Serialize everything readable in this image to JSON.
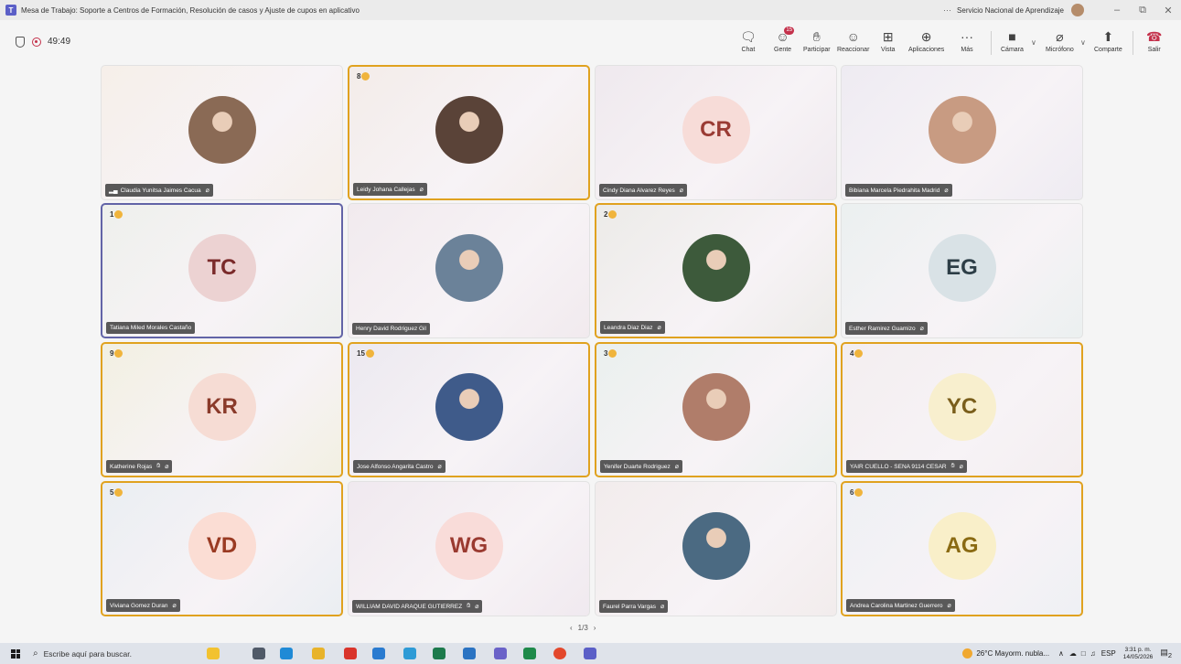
{
  "window": {
    "title": "Mesa de Trabajo: Soporte a Centros de Formación, Resolución de casos y Ajuste de cupos en aplicativo",
    "org": "Servicio Nacional de Aprendizaje",
    "more": "···",
    "minimize": "–",
    "restore": "⧉",
    "close": "✕"
  },
  "meeting": {
    "timer": "49:49",
    "buttons": {
      "chat": "Chat",
      "people": "Gente",
      "people_badge": "15",
      "raise": "Participar",
      "react": "Reaccionar",
      "view": "Vista",
      "apps": "Aplicaciones",
      "more": "Más",
      "camera": "Cámara",
      "mic": "Micrófono",
      "share": "Comparte",
      "leave": "Salir"
    }
  },
  "participants": [
    {
      "name": "Claudia Yunitsa Jaimes Cacua",
      "initials": "",
      "hand": "",
      "photo_color": "#8a6a55",
      "bg": "#f6efe9",
      "signal": "true"
    },
    {
      "name": "Leidy Johana Callejas",
      "initials": "",
      "hand": "8",
      "photo_color": "#5a4338",
      "bg": "#f3ece9"
    },
    {
      "name": "Cindy Diana Alvarez Reyes",
      "initials": "CR",
      "hand": "",
      "circle": "#f7dcd8",
      "fg": "#9a3b34",
      "bg": "#efe9ee"
    },
    {
      "name": "Bibiana Marcela Piedrahita Madrid",
      "initials": "",
      "hand": "",
      "photo_color": "#c89b82",
      "bg": "#eeebf2"
    },
    {
      "name": "Tatiana Miled Morales Castaño",
      "initials": "TC",
      "hand": "1",
      "circle": "#ecd2d2",
      "fg": "#7a2a2a",
      "bg": "#eef0ec",
      "active": "true"
    },
    {
      "name": "Henry David Rodriguez Gil",
      "initials": "",
      "hand": "",
      "photo_color": "#6b8299",
      "bg": "#f1eaee"
    },
    {
      "name": "Leandra Diaz Diaz",
      "initials": "",
      "hand": "2",
      "photo_color": "#3d5a3b",
      "bg": "#ecebe8"
    },
    {
      "name": "Esther Ramirez Guamizo",
      "initials": "EG",
      "hand": "",
      "circle": "#d9e2e6",
      "fg": "#2d3e47",
      "bg": "#ebf0f0"
    },
    {
      "name": "Katherine Rojas",
      "initials": "KR",
      "hand": "9",
      "circle": "#f6dcd4",
      "fg": "#8a3a2a",
      "bg": "#f2f0e2",
      "extra": "true"
    },
    {
      "name": "Jose Alfonso Angarita Castro",
      "initials": "",
      "hand": "15",
      "photo_color": "#3f5b8a",
      "bg": "#ece9f0"
    },
    {
      "name": "Yenifer Duarte Rodriguez",
      "initials": "",
      "hand": "3",
      "photo_color": "#b07d6a",
      "bg": "#eaf0ee"
    },
    {
      "name": "YAIR CUELLO - SENA 9114 CESAR",
      "initials": "YC",
      "hand": "4",
      "circle": "#f8efce",
      "fg": "#7a5e1b",
      "bg": "#f3eef0",
      "extra": "true"
    },
    {
      "name": "Viviana Gomez Duran",
      "initials": "VD",
      "hand": "5",
      "circle": "#fbddd4",
      "fg": "#9a3a22",
      "bg": "#eaeef2"
    },
    {
      "name": "WILLIAM DAVID ARAQUE GUTIERREZ",
      "initials": "WG",
      "hand": "",
      "circle": "#f9dcd9",
      "fg": "#9a3a30",
      "bg": "#f0e9ef",
      "extra": "true"
    },
    {
      "name": "Faurel Parra Vargas",
      "initials": "",
      "hand": "",
      "photo_color": "#4b6a82",
      "bg": "#f2ecec"
    },
    {
      "name": "Andrea Carolina Martinez Guerrero",
      "initials": "AG",
      "hand": "6",
      "circle": "#f9efc9",
      "fg": "#8a6a12",
      "bg": "#eef0f4"
    }
  ],
  "pager": {
    "prev": "‹",
    "label": "1/3",
    "next": "›"
  },
  "taskbar": {
    "search_placeholder": "Escribe aquí para buscar.",
    "weather": "26°C  Mayorm. nubla...",
    "lang": "ESP",
    "time": "3:31 p. m.",
    "date": "14/05/2026",
    "notif_count": "2"
  }
}
